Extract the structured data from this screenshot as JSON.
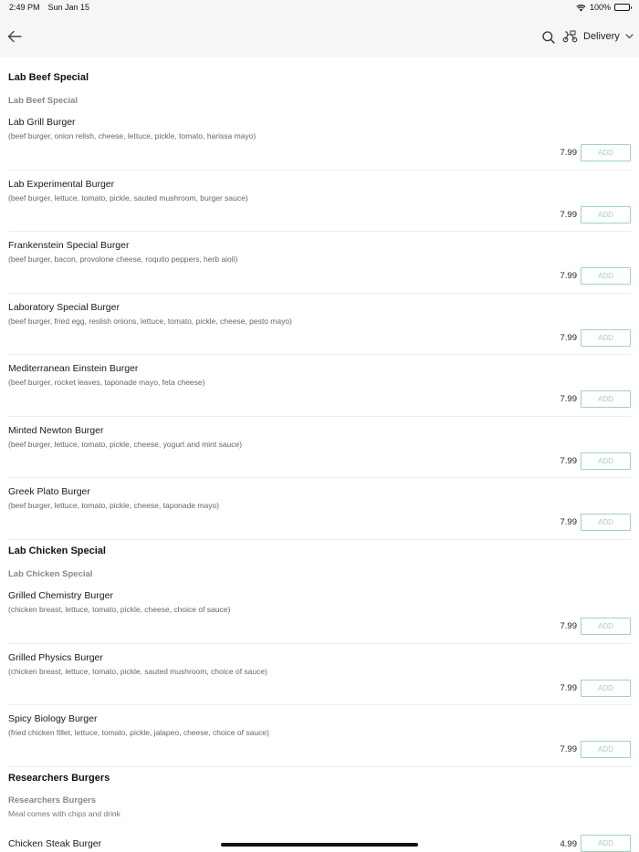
{
  "status_bar": {
    "time": "2:49 PM",
    "date": "Sun Jan 15",
    "battery": "100%"
  },
  "nav": {
    "delivery_label": "Delivery"
  },
  "sections": [
    {
      "title": "Lab Beef Special",
      "subtitle": "Lab Beef Special"
    },
    {
      "title": "Lab Chicken Special",
      "subtitle": "Lab Chicken Special"
    },
    {
      "title": "Researchers Burgers",
      "subtitle": "Researchers Burgers",
      "note": "Meal comes with chips and drink"
    }
  ],
  "items": [
    {
      "name": "Lab Grill Burger",
      "desc": "(beef burger, onion relish, cheese, lettuce, pickle, tomato, harissa mayo)",
      "price": "7.99"
    },
    {
      "name": "Lab Experimental Burger",
      "desc": "(beef burger, lettuce, tomato, pickle, sauted mushroom, burger sauce)",
      "price": "7.99"
    },
    {
      "name": "Frankenstein Special Burger",
      "desc": "(beef burger, bacon, provolone cheese, roquito peppers, herb aioli)",
      "price": "7.99"
    },
    {
      "name": "Laboratory Special Burger",
      "desc": "(beef burger, fried egg, reslish onions, lettuce, tomato, pickle, cheese, pesto mayo)",
      "price": "7.99"
    },
    {
      "name": "Mediterranean Einstein Burger",
      "desc": "(beef burger, rocket leaves, taponade mayo, feta cheese)",
      "price": "7.99"
    },
    {
      "name": "Minted Newton Burger",
      "desc": "(beef burger, lettuce, tomato, pickle, cheese, yogurt and mint sauce)",
      "price": "7.99"
    },
    {
      "name": "Greek Plato Burger",
      "desc": "(beef burger, lettuce, tomato, pickle, cheese, taponade mayo)",
      "price": "7.99"
    },
    {
      "name": "Grilled Chemistry Burger",
      "desc": "(chicken breast, lettuce, tomato, pickle, cheese, choice of sauce)",
      "price": "7.99"
    },
    {
      "name": "Grilled Physics Burger",
      "desc": "(chicken breast, lettuce, tomato, pickle, sauted mushroom, choice of sauce)",
      "price": "7.99"
    },
    {
      "name": "Spicy Biology Burger",
      "desc": "(fried chicken fillet, lettuce, tomato, pickle, jalapeo, cheese, choice of sauce)",
      "price": "7.99"
    },
    {
      "name": "Chicken Steak Burger",
      "desc": "",
      "price": "4.99"
    }
  ],
  "add_label": "ADD",
  "colors": {
    "accent_outline": "#9fd4bd",
    "nav_background": "#f6f6f6"
  }
}
